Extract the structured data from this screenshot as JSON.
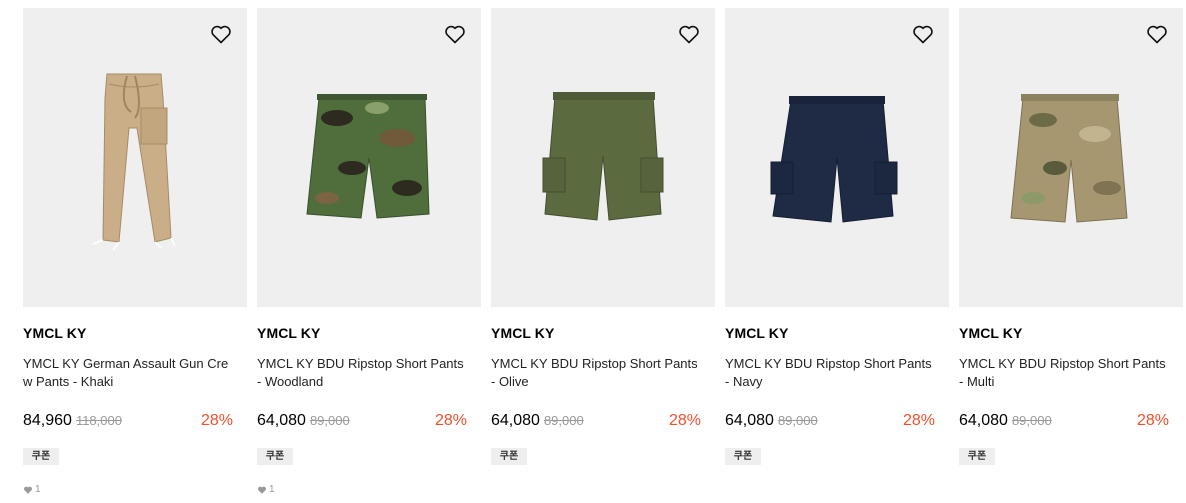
{
  "products": [
    {
      "brand": "YMCL KY",
      "name": "YMCL KY German Assault Gun Crew Pants - Khaki",
      "price": "84,960",
      "original_price": "118,000",
      "discount": "28%",
      "coupon": "쿠폰",
      "likes": "1",
      "heart_icon": "heart-outline-icon",
      "image": "khaki-long-pants"
    },
    {
      "brand": "YMCL KY",
      "name": "YMCL KY BDU Ripstop Short Pants - Woodland",
      "price": "64,080",
      "original_price": "89,000",
      "discount": "28%",
      "coupon": "쿠폰",
      "likes": "1",
      "heart_icon": "heart-outline-icon",
      "image": "woodland-camo-shorts"
    },
    {
      "brand": "YMCL KY",
      "name": "YMCL KY BDU Ripstop Short Pants - Olive",
      "price": "64,080",
      "original_price": "89,000",
      "discount": "28%",
      "coupon": "쿠폰",
      "likes": null,
      "heart_icon": "heart-outline-icon",
      "image": "olive-shorts"
    },
    {
      "brand": "YMCL KY",
      "name": "YMCL KY BDU Ripstop Short Pants - Navy",
      "price": "64,080",
      "original_price": "89,000",
      "discount": "28%",
      "coupon": "쿠폰",
      "likes": null,
      "heart_icon": "heart-outline-icon",
      "image": "navy-shorts"
    },
    {
      "brand": "YMCL KY",
      "name": "YMCL KY BDU Ripstop Short Pants - Multi",
      "price": "64,080",
      "original_price": "89,000",
      "discount": "28%",
      "coupon": "쿠폰",
      "likes": null,
      "heart_icon": "heart-outline-icon",
      "image": "multicam-shorts"
    }
  ],
  "colors": {
    "discount": "#f0502c",
    "thumb_bg": "#efefef",
    "muted": "#9a9a9a"
  }
}
